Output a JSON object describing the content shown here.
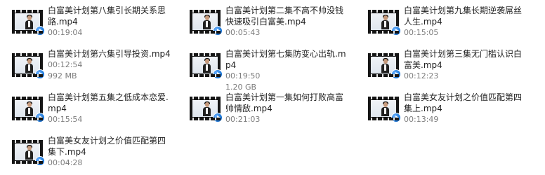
{
  "files": [
    {
      "name": "白富美计划第八集引长期关系思路.mp4",
      "meta": [
        "00:19:04"
      ]
    },
    {
      "name": "白富美计划第二集不高不帅没钱快速吸引白富美.mp4",
      "meta": [
        "00:05:43"
      ]
    },
    {
      "name": "白富美计划第九集长期逆袭屌丝人生.mp4",
      "meta": [
        "00:15:05"
      ]
    },
    {
      "name": "白富美计划第六集引导投资.mp4",
      "meta": [
        "00:12:54",
        "992 MB"
      ]
    },
    {
      "name": "白富美计划第七集防变心出轨.mp4",
      "meta": [
        "00:19:50",
        "1.20 GB"
      ]
    },
    {
      "name": "白富美计划第三集无门槛认识白富美.mp4",
      "meta": [
        "00:12:23"
      ]
    },
    {
      "name": "白富美计划第五集之低成本恋爱.mp4",
      "meta": [
        "00:15:54"
      ]
    },
    {
      "name": "白富美计划第一集如何打败高富帅情敌.mp4",
      "meta": [
        "00:21:03"
      ]
    },
    {
      "name": "白富美女友计划之价值匹配第四集上.mp4",
      "meta": [
        "00:13:49"
      ]
    },
    {
      "name": "白富美女友计划之价值匹配第四集下.mp4",
      "meta": [
        "00:04:28"
      ]
    }
  ]
}
